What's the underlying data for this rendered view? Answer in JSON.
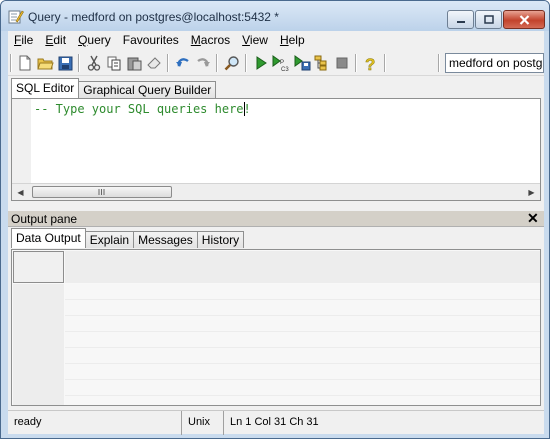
{
  "window": {
    "title": "Query - medford on postgres@localhost:5432 *"
  },
  "menu": [
    {
      "label": "File",
      "key": "F",
      "rest": "ile"
    },
    {
      "label": "Edit",
      "key": "E",
      "rest": "dit"
    },
    {
      "label": "Query",
      "key": "Q",
      "rest": "uery"
    },
    {
      "label": "Favourites",
      "key": "",
      "rest": "Favourites"
    },
    {
      "label": "Macros",
      "key": "M",
      "rest": "acros"
    },
    {
      "label": "View",
      "key": "V",
      "rest": "iew"
    },
    {
      "label": "Help",
      "key": "H",
      "rest": "elp"
    }
  ],
  "toolbar": {
    "icons": [
      "new-file-icon",
      "open-folder-icon",
      "save-icon",
      "cut-icon",
      "copy-icon",
      "paste-icon",
      "clear-icon",
      "undo-icon",
      "redo-icon",
      "find-icon",
      "execute-icon",
      "explain-icon",
      "execute-to-file-icon",
      "explain-analyze-icon",
      "cancel-query-icon",
      "help-icon"
    ],
    "connection": "medford on postgres"
  },
  "editor": {
    "tabs": [
      "SQL Editor",
      "Graphical Query Builder"
    ],
    "active_tab": "SQL Editor",
    "content": "-- Type your SQL queries here!",
    "text_color": "#2e8b2e"
  },
  "output": {
    "title": "Output pane",
    "close_symbol": "✕",
    "tabs": [
      "Data Output",
      "Explain",
      "Messages",
      "History"
    ],
    "active_tab": "Data Output"
  },
  "status": {
    "state": "ready",
    "line_ending": "Unix",
    "position": "Ln 1 Col 31 Ch 31"
  }
}
